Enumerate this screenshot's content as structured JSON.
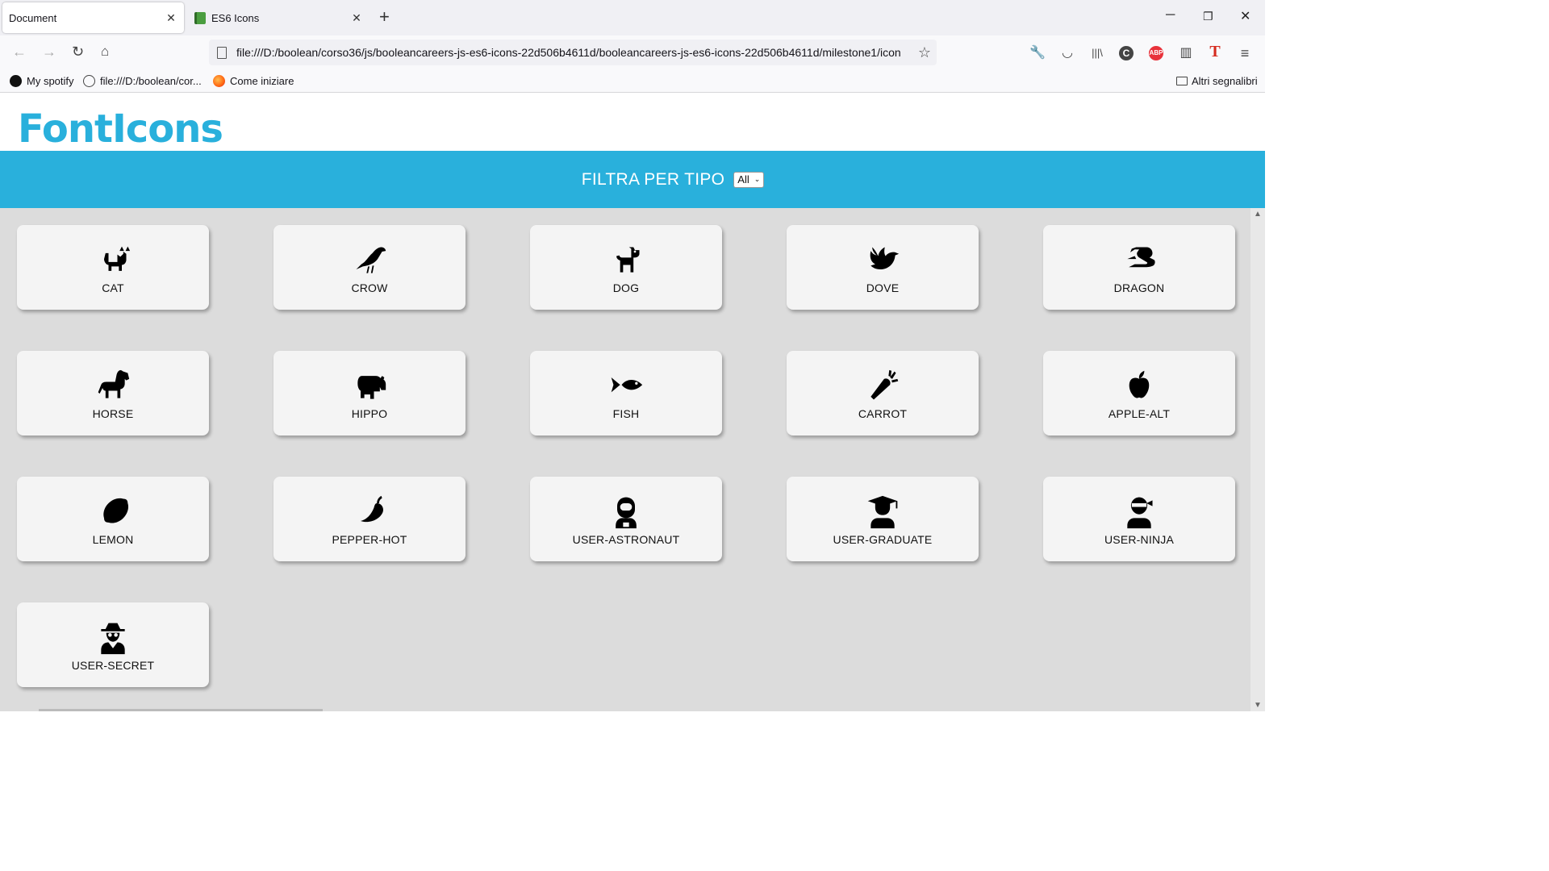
{
  "browser": {
    "tabs": [
      {
        "label": "Document",
        "active": true
      },
      {
        "label": "ES6 Icons",
        "active": false
      }
    ],
    "url": "file:///D:/boolean/corso36/js/booleancareers-js-es6-icons-22d506b4611d/booleancareers-js-es6-icons-22d506b4611d/milestone1/icon",
    "bookmarks": [
      "My spotify",
      "file:///D:/boolean/cor...",
      "Come iniziare"
    ],
    "other_bookmarks": "Altri segnalibri"
  },
  "page": {
    "logo": "FontIcons",
    "filter_label": "FILTRA PER TIPO",
    "filter_value": "All",
    "accent_color": "#29b0dc",
    "icons": [
      {
        "name": "CAT",
        "icon": "cat-icon"
      },
      {
        "name": "CROW",
        "icon": "crow-icon"
      },
      {
        "name": "DOG",
        "icon": "dog-icon"
      },
      {
        "name": "DOVE",
        "icon": "dove-icon"
      },
      {
        "name": "DRAGON",
        "icon": "dragon-icon"
      },
      {
        "name": "HORSE",
        "icon": "horse-icon"
      },
      {
        "name": "HIPPO",
        "icon": "hippo-icon"
      },
      {
        "name": "FISH",
        "icon": "fish-icon"
      },
      {
        "name": "CARROT",
        "icon": "carrot-icon"
      },
      {
        "name": "APPLE-ALT",
        "icon": "apple-alt-icon"
      },
      {
        "name": "LEMON",
        "icon": "lemon-icon"
      },
      {
        "name": "PEPPER-HOT",
        "icon": "pepper-hot-icon"
      },
      {
        "name": "USER-ASTRONAUT",
        "icon": "user-astronaut-icon"
      },
      {
        "name": "USER-GRADUATE",
        "icon": "user-graduate-icon"
      },
      {
        "name": "USER-NINJA",
        "icon": "user-ninja-icon"
      },
      {
        "name": "USER-SECRET",
        "icon": "user-secret-icon"
      }
    ]
  }
}
